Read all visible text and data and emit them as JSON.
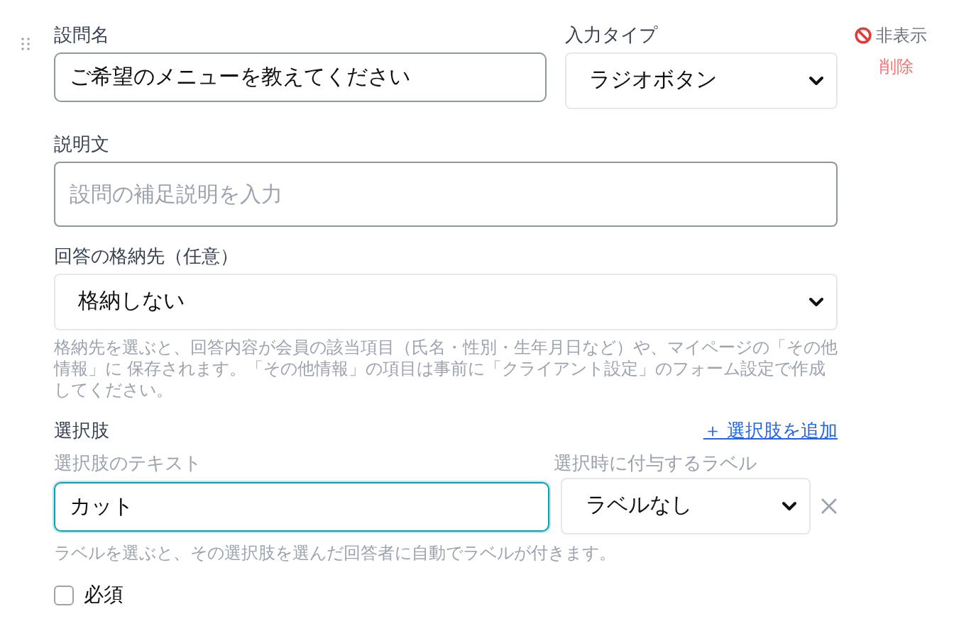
{
  "question": {
    "name_label": "設問名",
    "name_value": "ご希望のメニューを教えてください",
    "type_label": "入力タイプ",
    "type_value": "ラジオボタン"
  },
  "actions": {
    "hide": "非表示",
    "delete": "削除"
  },
  "description": {
    "label": "説明文",
    "placeholder": "設問の補足説明を入力"
  },
  "storage": {
    "label": "回答の格納先（任意）",
    "value": "格納しない",
    "help": "格納先を選ぶと、回答内容が会員の該当項目（氏名・性別・生年月日など）や、マイページの「その他情報」に 保存されます。「その他情報」の項目は事前に「クライアント設定」のフォーム設定で作成してください。"
  },
  "choices": {
    "label": "選択肢",
    "add": "＋ 選択肢を追加",
    "text_label": "選択肢のテキスト",
    "tag_label": "選択時に付与するラベル",
    "items": [
      {
        "text": "カット",
        "tag": "ラベルなし",
        "focused": true
      }
    ],
    "help": "ラベルを選ぶと、その選択肢を選んだ回答者に自動でラベルが付きます。"
  },
  "required": {
    "label": "必須",
    "checked": false
  }
}
